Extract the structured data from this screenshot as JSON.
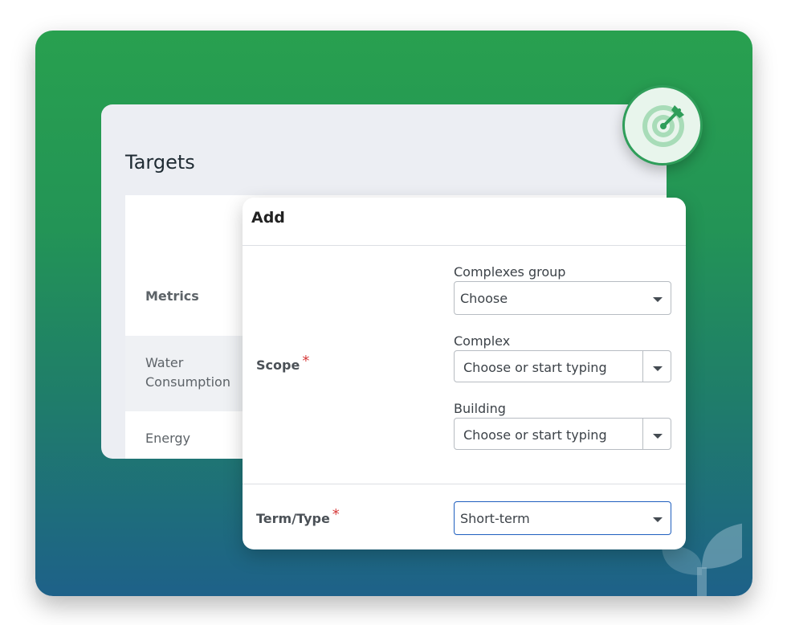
{
  "targets": {
    "title": "Targets",
    "metrics_header": "Metrics",
    "rows": [
      {
        "label": "Water Consumption"
      },
      {
        "label": "Energy"
      }
    ]
  },
  "badge": {
    "icon": "target-arrow-icon"
  },
  "modal": {
    "title": "Add",
    "scope": {
      "label": "Scope",
      "required_mark": "*",
      "complexes_group": {
        "label": "Complexes group",
        "value": "Choose"
      },
      "complex": {
        "label": "Complex",
        "placeholder": "Choose or start typing"
      },
      "building": {
        "label": "Building",
        "placeholder": "Choose or start typing"
      }
    },
    "term_type": {
      "label": "Term/Type",
      "required_mark": "*",
      "value": "Short-term"
    }
  },
  "colors": {
    "green": "#28a04f",
    "blue": "#1e6189",
    "required": "#d63b3b",
    "focus": "#1f5fbf"
  }
}
